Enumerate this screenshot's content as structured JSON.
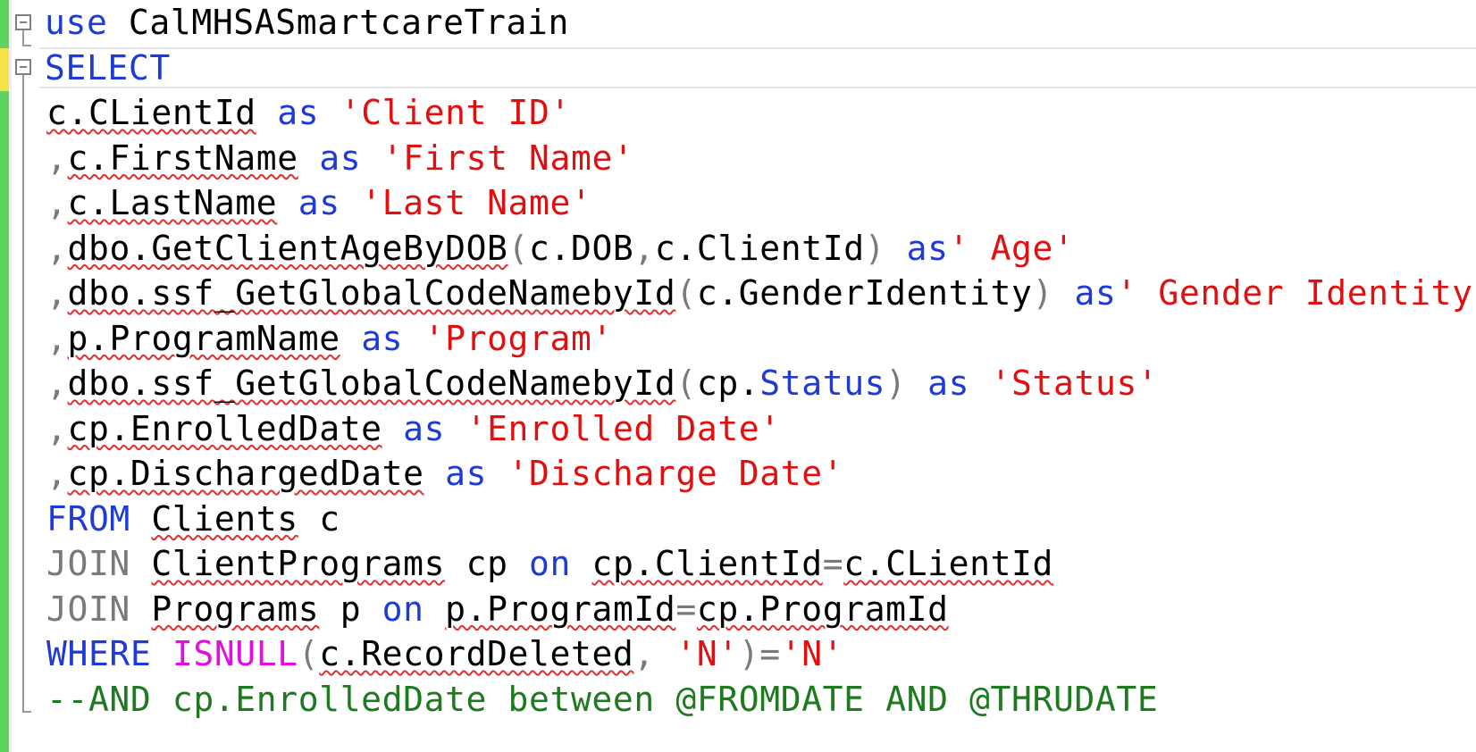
{
  "editor": {
    "lines": [
      {
        "fold": true,
        "tokens": [
          {
            "t": "use ",
            "c": "kw"
          },
          {
            "t": "CalMHSASmartcareTrain",
            "c": ""
          }
        ]
      },
      {
        "fold": true,
        "tokens": [
          {
            "t": "SELECT",
            "c": "kw"
          }
        ]
      },
      {
        "tokens": [
          {
            "t": "c.CLientId",
            "c": "sq"
          },
          {
            "t": " ",
            "c": ""
          },
          {
            "t": "as",
            "c": "kw"
          },
          {
            "t": " ",
            "c": ""
          },
          {
            "t": "'Client ID'",
            "c": "str"
          }
        ]
      },
      {
        "tokens": [
          {
            "t": ",",
            "c": "gray"
          },
          {
            "t": "c.FirstName",
            "c": "sq"
          },
          {
            "t": " ",
            "c": ""
          },
          {
            "t": "as",
            "c": "kw"
          },
          {
            "t": " ",
            "c": ""
          },
          {
            "t": "'First Name'",
            "c": "str"
          }
        ]
      },
      {
        "tokens": [
          {
            "t": ",",
            "c": "gray"
          },
          {
            "t": "c.LastName",
            "c": "sq"
          },
          {
            "t": " ",
            "c": ""
          },
          {
            "t": "as",
            "c": "kw"
          },
          {
            "t": " ",
            "c": ""
          },
          {
            "t": "'Last Name'",
            "c": "str"
          }
        ]
      },
      {
        "tokens": [
          {
            "t": ",",
            "c": "gray"
          },
          {
            "t": "dbo.GetClientAgeByDOB",
            "c": "sq"
          },
          {
            "t": "(",
            "c": "gray"
          },
          {
            "t": "c.DOB",
            "c": ""
          },
          {
            "t": ",",
            "c": "gray"
          },
          {
            "t": "c.ClientId",
            "c": ""
          },
          {
            "t": ")",
            "c": "gray"
          },
          {
            "t": " ",
            "c": ""
          },
          {
            "t": "as",
            "c": "kw"
          },
          {
            "t": "' Age'",
            "c": "str"
          }
        ]
      },
      {
        "tokens": [
          {
            "t": ",",
            "c": "gray"
          },
          {
            "t": "dbo.ssf_GetGlobalCodeNamebyId",
            "c": "sq"
          },
          {
            "t": "(",
            "c": "gray"
          },
          {
            "t": "c.GenderIdentity",
            "c": ""
          },
          {
            "t": ")",
            "c": "gray"
          },
          {
            "t": " ",
            "c": ""
          },
          {
            "t": "as",
            "c": "kw"
          },
          {
            "t": "' Gender Identity'",
            "c": "str"
          }
        ]
      },
      {
        "tokens": [
          {
            "t": ",",
            "c": "gray"
          },
          {
            "t": "p.ProgramName",
            "c": "sq"
          },
          {
            "t": " ",
            "c": ""
          },
          {
            "t": "as",
            "c": "kw"
          },
          {
            "t": " ",
            "c": ""
          },
          {
            "t": "'Program'",
            "c": "str"
          }
        ]
      },
      {
        "tokens": [
          {
            "t": ",",
            "c": "gray"
          },
          {
            "t": "dbo.ssf_GetGlobalCodeNamebyId",
            "c": "sq"
          },
          {
            "t": "(",
            "c": "gray"
          },
          {
            "t": "cp.",
            "c": ""
          },
          {
            "t": "Status",
            "c": "kw"
          },
          {
            "t": ")",
            "c": "gray"
          },
          {
            "t": " ",
            "c": ""
          },
          {
            "t": "as",
            "c": "kw"
          },
          {
            "t": " ",
            "c": ""
          },
          {
            "t": "'Status'",
            "c": "str"
          }
        ]
      },
      {
        "tokens": [
          {
            "t": ",",
            "c": "gray"
          },
          {
            "t": "cp.EnrolledDate",
            "c": "sq"
          },
          {
            "t": " ",
            "c": ""
          },
          {
            "t": "as",
            "c": "kw"
          },
          {
            "t": " ",
            "c": ""
          },
          {
            "t": "'Enrolled Date'",
            "c": "str"
          }
        ]
      },
      {
        "tokens": [
          {
            "t": ",",
            "c": "gray"
          },
          {
            "t": "cp.DischargedDate",
            "c": "sq"
          },
          {
            "t": " ",
            "c": ""
          },
          {
            "t": "as",
            "c": "kw"
          },
          {
            "t": " ",
            "c": ""
          },
          {
            "t": "'Discharge Date'",
            "c": "str"
          }
        ]
      },
      {
        "tokens": [
          {
            "t": "FROM",
            "c": "kw"
          },
          {
            "t": " ",
            "c": ""
          },
          {
            "t": "Clients",
            "c": "sq"
          },
          {
            "t": " c",
            "c": ""
          }
        ]
      },
      {
        "tokens": [
          {
            "t": "JOIN",
            "c": "gray"
          },
          {
            "t": " ",
            "c": ""
          },
          {
            "t": "ClientPrograms",
            "c": "sq"
          },
          {
            "t": " cp ",
            "c": ""
          },
          {
            "t": "on",
            "c": "kw"
          },
          {
            "t": " ",
            "c": ""
          },
          {
            "t": "cp.ClientId",
            "c": "sq"
          },
          {
            "t": "=",
            "c": "gray"
          },
          {
            "t": "c.CLientId",
            "c": "sq"
          }
        ]
      },
      {
        "tokens": [
          {
            "t": "JOIN",
            "c": "gray"
          },
          {
            "t": " ",
            "c": ""
          },
          {
            "t": "Programs",
            "c": "sq"
          },
          {
            "t": " p ",
            "c": ""
          },
          {
            "t": "on",
            "c": "kw"
          },
          {
            "t": " ",
            "c": ""
          },
          {
            "t": "p.ProgramId",
            "c": "sq"
          },
          {
            "t": "=",
            "c": "gray"
          },
          {
            "t": "cp.ProgramId",
            "c": "sq"
          }
        ]
      },
      {
        "tokens": [
          {
            "t": "WHERE",
            "c": "kw"
          },
          {
            "t": " ",
            "c": ""
          },
          {
            "t": "ISNULL",
            "c": "fn"
          },
          {
            "t": "(",
            "c": "gray"
          },
          {
            "t": "c.RecordDeleted",
            "c": "sq"
          },
          {
            "t": ",",
            "c": "gray"
          },
          {
            "t": " ",
            "c": ""
          },
          {
            "t": "'N'",
            "c": "str"
          },
          {
            "t": ")",
            "c": "gray"
          },
          {
            "t": "=",
            "c": "gray"
          },
          {
            "t": "'N'",
            "c": "str"
          }
        ]
      },
      {
        "tokens": [
          {
            "t": "--AND cp.EnrolledDate between @FROMDATE AND @THRUDATE",
            "c": "cm"
          }
        ]
      }
    ]
  }
}
